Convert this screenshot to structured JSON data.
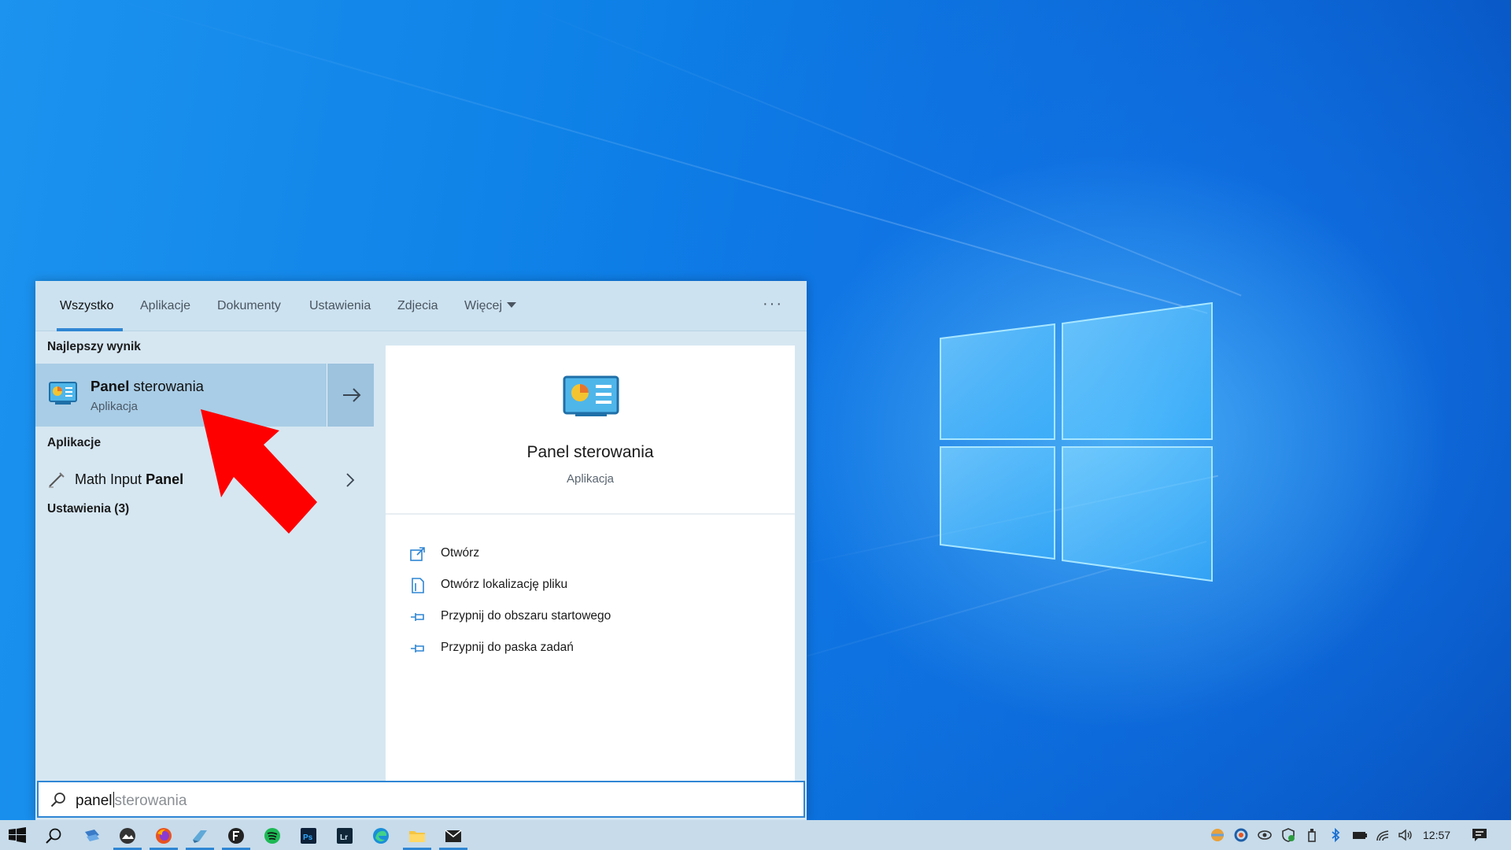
{
  "tabs": {
    "all": "Wszystko",
    "apps": "Aplikacje",
    "docs": "Dokumenty",
    "settings": "Ustawienia",
    "photos": "Zdjecia",
    "more": "Więcej",
    "ellipsis": "···"
  },
  "results": {
    "best_header": "Najlepszy wynik",
    "best_title_bold": "Panel",
    "best_title_rest": " sterowania",
    "best_subtitle": "Aplikacja",
    "apps_header": "Aplikacje",
    "app_item_rest": "Math Input ",
    "app_item_bold": "Panel",
    "settings_header": "Ustawienia (3)"
  },
  "preview": {
    "title": "Panel sterowania",
    "subtitle": "Aplikacja",
    "actions": [
      "Otwórz",
      "Otwórz lokalizację pliku",
      "Przypnij do obszaru startowego",
      "Przypnij do paska zadań"
    ]
  },
  "search": {
    "typed": "panel",
    "suggestion": "sterowania"
  },
  "taskbar": {
    "clock": "12:57"
  },
  "colors": {
    "accent": "#2f86d4",
    "arrow": "#ff0000",
    "selection": "#a9cde6"
  }
}
